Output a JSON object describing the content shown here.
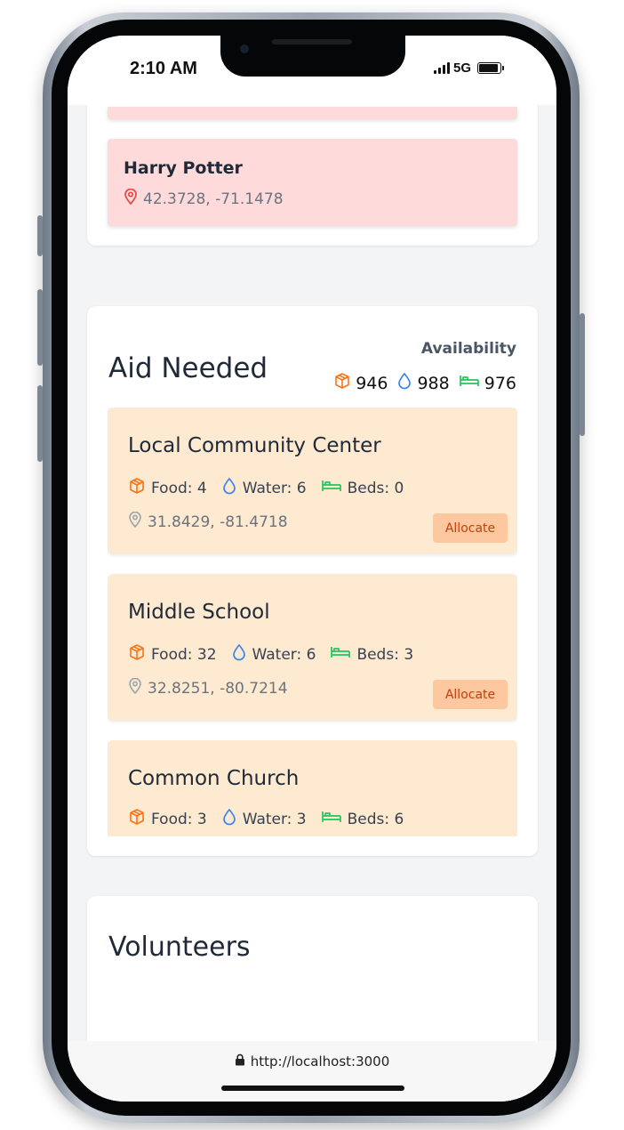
{
  "status_bar": {
    "time": "2:10 AM",
    "network": "5G"
  },
  "reports": {
    "items": [
      {
        "name": "",
        "coords": ""
      },
      {
        "name": "Harry Potter",
        "coords": "42.3728, -71.1478"
      }
    ]
  },
  "aid_needed": {
    "title": "Aid Needed",
    "availability_label": "Availability",
    "availability": {
      "food": "946",
      "water": "988",
      "beds": "976"
    },
    "items": [
      {
        "name": "Local Community Center",
        "food": "Food: 4",
        "water": "Water: 6",
        "beds": "Beds: 0",
        "coords": "31.8429, -81.4718",
        "button": "Allocate"
      },
      {
        "name": "Middle School",
        "food": "Food: 32",
        "water": "Water: 6",
        "beds": "Beds: 3",
        "coords": "32.8251, -80.7214",
        "button": "Allocate"
      },
      {
        "name": "Common Church",
        "food": "Food: 3",
        "water": "Water: 3",
        "beds": "Beds: 6",
        "coords": "",
        "button": ""
      }
    ]
  },
  "volunteers": {
    "title": "Volunteers"
  },
  "browser": {
    "url": "http://localhost:3000"
  },
  "colors": {
    "food": "#f97316",
    "water": "#3b82f6",
    "beds": "#22c55e",
    "report_bg": "#fedadb",
    "aid_bg": "#feead0",
    "allocate_bg": "#fdc79f",
    "allocate_text": "#c2410c"
  },
  "icons": {
    "food": "package-icon",
    "water": "droplet-icon",
    "beds": "bed-icon",
    "location": "map-pin-icon",
    "secure": "lock-icon"
  }
}
